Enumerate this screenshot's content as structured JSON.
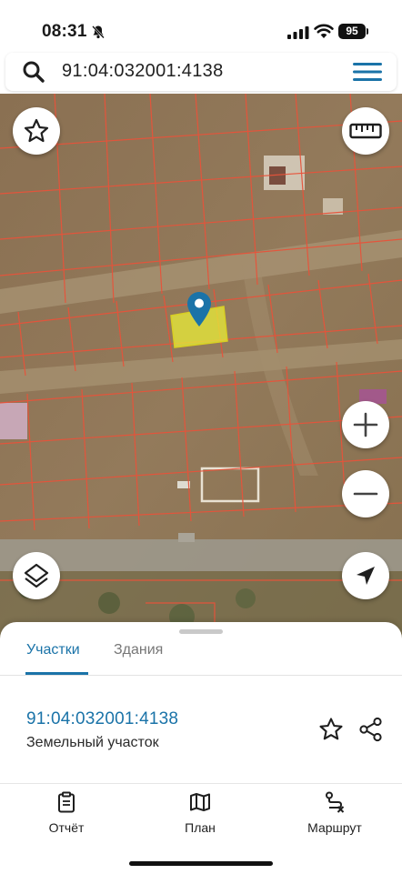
{
  "status_bar": {
    "time": "08:31",
    "battery": "95"
  },
  "search": {
    "query": "91:04:032001:4138"
  },
  "map": {
    "icons": {
      "favorite": "star-outline-icon",
      "ruler": "ruler-icon",
      "zoom_in": "plus-icon",
      "zoom_out": "minus-icon",
      "layers": "layers-icon",
      "locate": "navigation-arrow-icon",
      "marker": "map-pin-icon"
    },
    "colors": {
      "parcel_border": "#e8533a",
      "selected_parcel": "#e5e63a",
      "marker": "#1a73a8"
    }
  },
  "sheet": {
    "tabs": [
      {
        "label": "Участки",
        "active": true
      },
      {
        "label": "Здания",
        "active": false
      }
    ],
    "result": {
      "id": "91:04:032001:4138",
      "type": "Земельный участок"
    }
  },
  "bottom_nav": [
    {
      "label": "Отчёт",
      "icon": "report-icon"
    },
    {
      "label": "План",
      "icon": "map-plan-icon"
    },
    {
      "label": "Маршрут",
      "icon": "route-icon"
    }
  ],
  "accent_color": "#1a73a8"
}
